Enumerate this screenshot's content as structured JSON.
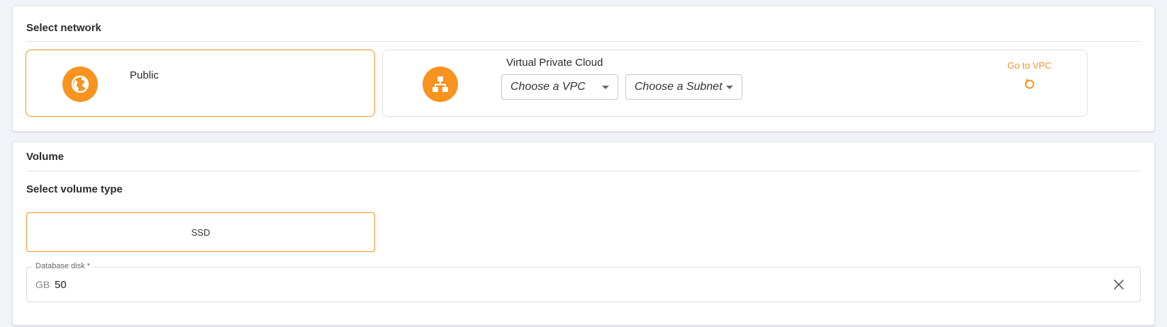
{
  "network": {
    "title": "Select network",
    "public": {
      "label": "Public"
    },
    "vpc": {
      "label": "Virtual Private Cloud",
      "vpc_select": {
        "value": "Choose a VPC"
      },
      "subnet_select": {
        "value": "Choose a Subnet"
      },
      "goto_label": "Go to VPC"
    }
  },
  "volume": {
    "title": "Volume",
    "type_title": "Select volume type",
    "type_option": "SSD",
    "disk": {
      "legend": "Database disk *",
      "unit": "GB",
      "value": "50"
    }
  },
  "colors": {
    "accent": "#f7931e",
    "border": "#e0e0e0"
  },
  "icons": [
    "globe-icon",
    "network-hierarchy-icon",
    "refresh-icon",
    "chevron-down-icon",
    "close-icon"
  ]
}
